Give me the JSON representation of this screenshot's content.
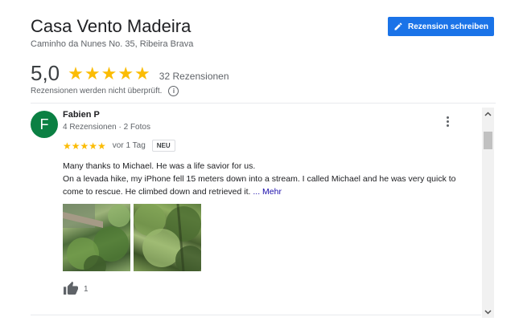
{
  "business": {
    "name": "Casa Vento Madeira",
    "address": "Caminho da Nunes No. 35, Ribeira Brava"
  },
  "write_review_button": {
    "label": "Rezension schreiben",
    "icon": "pencil-icon"
  },
  "summary": {
    "rating": "5,0",
    "stars": "★★★★★",
    "review_count": "32 Rezensionen",
    "notice": "Rezensionen werden nicht überprüft.",
    "info_icon_glyph": "i"
  },
  "review": {
    "avatar_letter": "F",
    "avatar_color": "#0b8043",
    "author": "Fabien P",
    "author_meta": "4 Rezensionen · 2 Fotos",
    "stars": "★★★★★",
    "date": "vor 1 Tag",
    "badge": "NEU",
    "text_line1": "Many thanks to Michael. He was a life savior for us.",
    "text_line2": "On a levada hike, my iPhone fell 15 meters down into a stream. I called Michael and he was very quick to come to rescue. He climbed down and retrieved it.",
    "more_link": "... Mehr",
    "photos": [
      "levada-cliff-photo",
      "mossy-stream-photo"
    ],
    "likes": "1"
  },
  "colors": {
    "accent": "#1a73e8",
    "star": "#fbbc04",
    "link": "#1a0dab"
  }
}
